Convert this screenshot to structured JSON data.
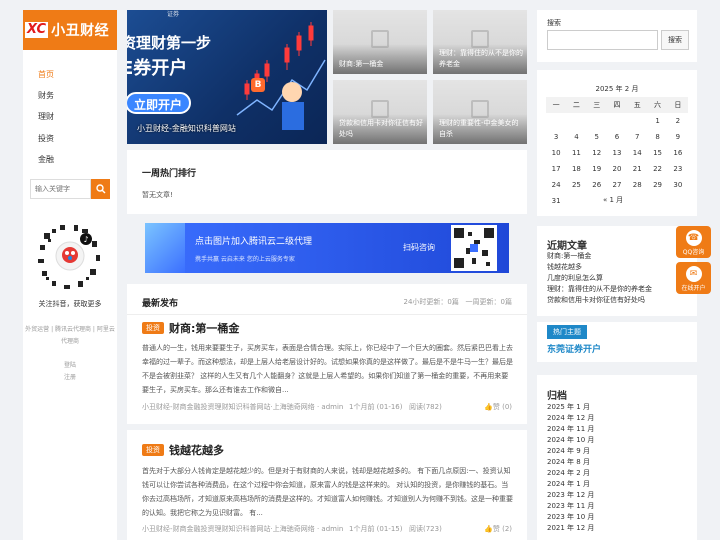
{
  "logo": {
    "badge": "XC",
    "name": "小丑财经"
  },
  "nav": [
    "首页",
    "财务",
    "理财",
    "投资",
    "金融"
  ],
  "side_search": {
    "placeholder": "输入关键字"
  },
  "qr_caption": "关注抖音，获取更多",
  "footer_links": [
    "外贸运营 | 腾讯云代理商 | 阿里云代理商",
    "登陆",
    "注册"
  ],
  "hero": {
    "line1": "资理财第一步",
    "line2": "E券开户",
    "button": "立即开户",
    "caption": "小丑财经-金融知识科普网站",
    "badge": "B",
    "topmark": "证券"
  },
  "thumbs": [
    "财商:第一桶金",
    "理财：靠得住的从不是你的养老金",
    "贷款和信用卡对你征信有好处吗",
    "理财的重要性-中金美女的自杀"
  ],
  "hot": {
    "title": "一周热门排行",
    "empty": "暂无文章!"
  },
  "ad": {
    "title": "点击图片加入腾讯云二级代理",
    "sub": "携手共赢 云启未来 您的上云服务专家",
    "qr_label": "扫码咨询"
  },
  "latest": {
    "title": "最新发布",
    "stats": "24小时更新：0篇   一周更新：0篇",
    "posts": [
      {
        "tag": "投资",
        "title": "财商:第一桶金",
        "excerpt": "普通人的一生，钱用来要要生子，买房买车，表面是合情合理。实际上，你已经中了一个巨大的圈套。然后紧巴巴看上去幸福的过一辈子。而这种想法，却是上层人给老层设计好的。试想如果你真的是这样做了。最后是不是牛马一生？最后是不是会被割韭菜？ 这样的人生又有几个人能翻身？这就是上层人希望的。如果你们知道了第一桶金的重要，不再用来要要生子，买房买车。那么还有谁去工作和微自...",
        "meta": "小丑财经-财商金融投资理财知识科普网站·上海驰奇网络 · admin",
        "date": "1个月前 (01-16)",
        "views": "阅读(782)",
        "likes": "赞 (0)"
      },
      {
        "tag": "投资",
        "title": "钱越花越多",
        "excerpt": "首先对于大部分人钱肯定是越花越少的。但是对于有财商的人来说，钱却是越花越多的。 有下面几点原因:一、投资认知 钱可以让你尝试各种消费品，在这个过程中你会知道，原来富人的钱是这样来的。 对认知的投资，是你赚钱的基石。当你去过高档场所，才知道原来高档场所的消费是这样的。才知道富人如何赚钱。才知道别人为何赚不到钱。这是一种重要的认知。我把它称之为见识财富。 有...",
        "meta": "小丑财经-财商金融投资理财知识科普网站·上海驰奇网络 · admin",
        "date": "1个月前 (01-15)",
        "views": "阅读(723)",
        "likes": "赞 (2)"
      }
    ]
  },
  "right_search": {
    "label": "搜索",
    "button": "搜索"
  },
  "calendar": {
    "caption": "2025 年 2 月",
    "weekdays": [
      "一",
      "二",
      "三",
      "四",
      "五",
      "六",
      "日"
    ],
    "rows": [
      [
        "",
        "",
        "",
        "",
        "",
        "1",
        "2"
      ],
      [
        "3",
        "4",
        "5",
        "6",
        "7",
        "8",
        "9"
      ],
      [
        "10",
        "11",
        "12",
        "13",
        "14",
        "15",
        "16"
      ],
      [
        "17",
        "18",
        "19",
        "20",
        "21",
        "22",
        "23"
      ],
      [
        "24",
        "25",
        "26",
        "27",
        "28",
        "29",
        "30"
      ],
      [
        "31",
        "",
        "",
        "",
        "",
        "",
        ""
      ]
    ],
    "prev": "« 1 月"
  },
  "recent": {
    "title": "近期文章",
    "items": [
      "财商:第一桶金",
      "钱越花越多",
      "几度的利息怎么算",
      "理财：靠得住的从不是你的养老金",
      "贷款和信用卡对你征信有好处吗"
    ]
  },
  "hot_topic": {
    "label": "热门主题",
    "item": "东莞证券开户"
  },
  "archive": {
    "title": "归档",
    "items": [
      "2025 年 1 月",
      "2024 年 12 月",
      "2024 年 11 月",
      "2024 年 10 月",
      "2024 年 9 月",
      "2024 年 8 月",
      "2024 年 2 月",
      "2024 年 1 月",
      "2023 年 12 月",
      "2023 年 11 月",
      "2023 年 10 月",
      "2021 年 12 月"
    ]
  },
  "float": {
    "qq": "QQ咨询",
    "wx": "在线开户"
  },
  "colors": {
    "accent": "#ef7b16",
    "page_bg": "#f0f2f5"
  }
}
